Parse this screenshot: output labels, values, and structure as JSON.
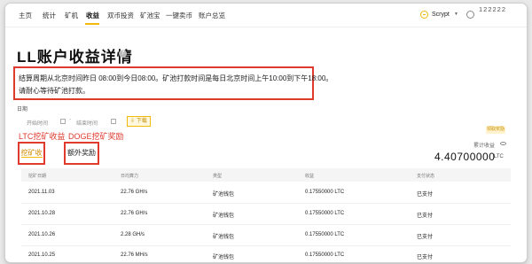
{
  "nav": {
    "items": [
      "主页",
      "统计",
      "矿机",
      "收益",
      "双币投资",
      "矿池宝",
      "一键卖币",
      "账户总览"
    ],
    "active": "收益",
    "algorithm": "Scrypt",
    "username": "122222"
  },
  "page": {
    "title": "LL账户收益详情",
    "notice_line1": "结算周期从北京时间昨日 08:00到今日08:00。矿池打款时间是每日北京时间上午10:00到下午18:00。",
    "notice_line2": "请耐心等待矿池打款。"
  },
  "filters": {
    "date_label": "日期",
    "start_placeholder": "开始时间",
    "end_placeholder": "结束时间",
    "download_label": "下载"
  },
  "annotations": {
    "ltc": "LTC挖矿收益",
    "doge": "DOGE挖矿奖励"
  },
  "tabs": {
    "mining": "挖矿收益",
    "extra": "额外奖励"
  },
  "summary": {
    "reward_button": "领取奖励",
    "cumulative_label": "累计收益",
    "cumulative_value": "4.40700000",
    "cumulative_unit": "LTC"
  },
  "table": {
    "headers": [
      "挖矿日期",
      "日均算力",
      "类型",
      "收益",
      "支付状态"
    ],
    "rows": [
      [
        "2021.11.03",
        "22.76 GH/s",
        "矿池钱包",
        "0.17550000 LTC",
        "已支付"
      ],
      [
        "2021.10.28",
        "22.76 GH/s",
        "矿池钱包",
        "0.17550000 LTC",
        "已支付"
      ],
      [
        "2021.10.26",
        "2.28 GH/s",
        "矿池钱包",
        "0.17550000 LTC",
        "已支付"
      ],
      [
        "2021.10.25",
        "22.76 MH/s",
        "矿池钱包",
        "0.17550000 LTC",
        "已支付"
      ]
    ]
  },
  "colors": {
    "accent": "#f0b90b",
    "annotation_red": "#e03a2e"
  }
}
